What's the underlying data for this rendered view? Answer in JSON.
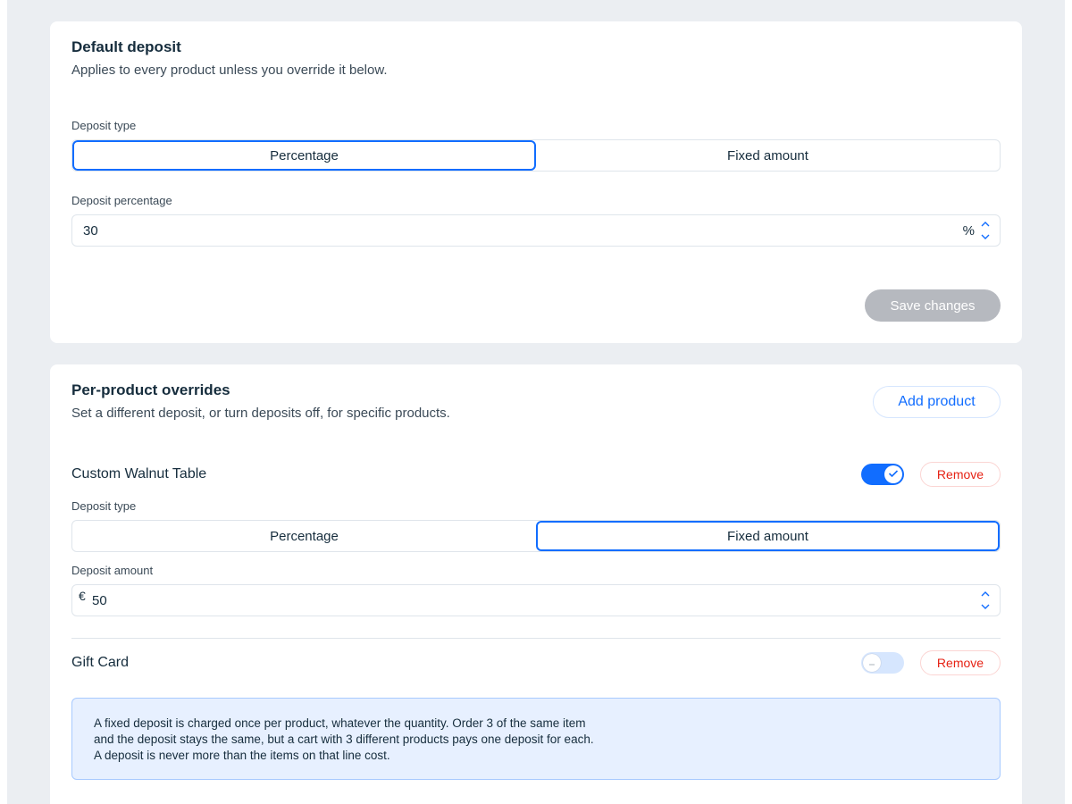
{
  "default_deposit": {
    "title": "Default deposit",
    "subtitle": "Applies to every product unless you override it below.",
    "deposit_type_label": "Deposit type",
    "type_options": [
      "Percentage",
      "Fixed amount"
    ],
    "selected_type": "Percentage",
    "percentage_label": "Deposit percentage",
    "percentage_value": "30",
    "percentage_suffix": "%",
    "save_label": "Save changes"
  },
  "overrides": {
    "title": "Per-product overrides",
    "subtitle": "Set a different deposit, or turn deposits off, for specific products.",
    "add_label": "Add product",
    "products": [
      {
        "name": "Custom Walnut Table",
        "enabled": true,
        "remove_label": "Remove",
        "deposit_type_label": "Deposit type",
        "type_options": [
          "Percentage",
          "Fixed amount"
        ],
        "selected_type": "Fixed amount",
        "amount_label": "Deposit amount",
        "currency_symbol": "€",
        "amount_value": "50"
      },
      {
        "name": "Gift Card",
        "enabled": false,
        "remove_label": "Remove"
      }
    ],
    "info_text": "A fixed deposit is charged once per product, whatever the quantity. Order 3 of the same item and the deposit stays the same, but a cart with 3 different products pays one deposit for each. A deposit is never more than the items on that line cost."
  },
  "colors": {
    "accent": "#116dff",
    "danger": "#e62214",
    "page_background": "#ebeef2",
    "info_background": "#e7f0ff",
    "disabled_button": "#b6b9bf"
  },
  "icons": {
    "stepper_up": "chevron-up-icon",
    "stepper_down": "chevron-down-icon",
    "toggle_check": "check-icon",
    "toggle_off": "minus-icon"
  }
}
